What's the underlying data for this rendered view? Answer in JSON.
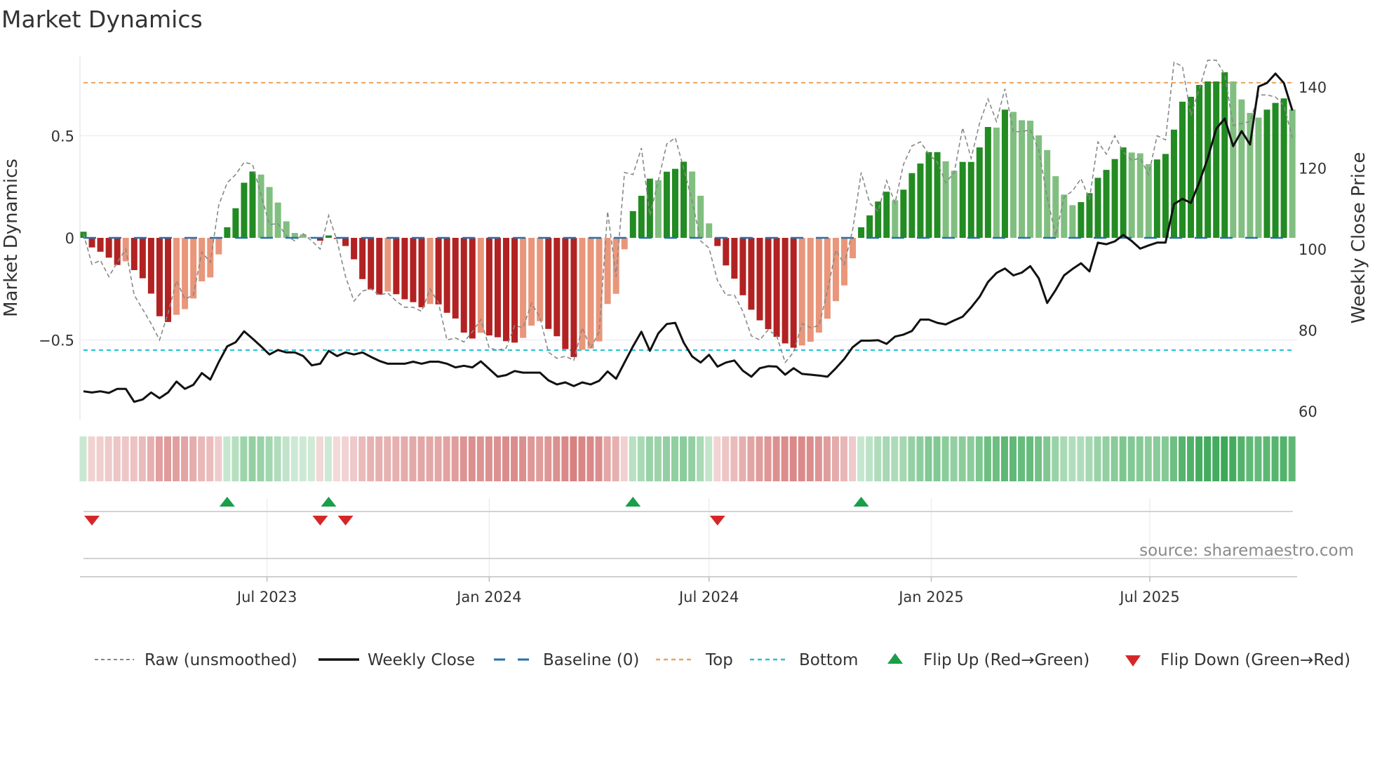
{
  "chart_data": {
    "type": "bar",
    "title": "Market Dynamics",
    "ylabel": "Market Dynamics",
    "ylabel_right": "Weekly Close Price",
    "ylim": [
      -0.75,
      0.95
    ],
    "ylim_right": [
      60,
      148
    ],
    "yticks": [
      {
        "value": 0.5,
        "label": "0.5"
      },
      {
        "value": 0,
        "label": "0"
      },
      {
        "value": -0.5,
        "label": "−0.5"
      }
    ],
    "yticks_right": [
      {
        "value": 140,
        "label": "140"
      },
      {
        "value": 120,
        "label": "120"
      },
      {
        "value": 100,
        "label": "100"
      },
      {
        "value": 80,
        "label": "80"
      },
      {
        "value": 60,
        "label": "60"
      }
    ],
    "xticks": [
      {
        "date": "2023-07-01",
        "label": "Jul 2023"
      },
      {
        "date": "2024-01-01",
        "label": "Jan 2024"
      },
      {
        "date": "2024-07-01",
        "label": "Jul 2024"
      },
      {
        "date": "2025-01-01",
        "label": "Jan 2025"
      },
      {
        "date": "2025-07-01",
        "label": "Jul 2025"
      }
    ],
    "start_week": "2023-01-30",
    "interval_days": 7,
    "top_level": 0.76,
    "bottom_level": -0.55,
    "baseline": 0,
    "grid": "horizontal",
    "legend_placement": "bottom",
    "smoothed": [
      0.03,
      -0.047,
      -0.068,
      -0.097,
      -0.133,
      -0.115,
      -0.158,
      -0.198,
      -0.273,
      -0.384,
      -0.412,
      -0.377,
      -0.349,
      -0.297,
      -0.213,
      -0.194,
      -0.081,
      0.052,
      0.145,
      0.27,
      0.325,
      0.31,
      0.249,
      0.173,
      0.081,
      0.024,
      0.017,
      0.004,
      -0.014,
      0.012,
      -0.005,
      -0.04,
      -0.105,
      -0.202,
      -0.253,
      -0.278,
      -0.263,
      -0.276,
      -0.301,
      -0.315,
      -0.34,
      -0.324,
      -0.326,
      -0.367,
      -0.395,
      -0.464,
      -0.493,
      -0.465,
      -0.478,
      -0.487,
      -0.506,
      -0.513,
      -0.49,
      -0.43,
      -0.408,
      -0.446,
      -0.482,
      -0.545,
      -0.584,
      -0.548,
      -0.542,
      -0.507,
      -0.324,
      -0.274,
      -0.056,
      0.131,
      0.206,
      0.29,
      0.282,
      0.324,
      0.338,
      0.373,
      0.325,
      0.206,
      0.071,
      -0.04,
      -0.135,
      -0.2,
      -0.281,
      -0.352,
      -0.404,
      -0.447,
      -0.485,
      -0.517,
      -0.538,
      -0.527,
      -0.509,
      -0.464,
      -0.396,
      -0.31,
      -0.233,
      -0.1,
      0.052,
      0.11,
      0.178,
      0.226,
      0.184,
      0.236,
      0.317,
      0.364,
      0.42,
      0.42,
      0.375,
      0.329,
      0.372,
      0.372,
      0.443,
      0.543,
      0.54,
      0.628,
      0.617,
      0.576,
      0.574,
      0.502,
      0.43,
      0.302,
      0.212,
      0.16,
      0.175,
      0.219,
      0.294,
      0.333,
      0.386,
      0.443,
      0.418,
      0.414,
      0.361,
      0.384,
      0.411,
      0.53,
      0.667,
      0.691,
      0.749,
      0.766,
      0.766,
      0.811,
      0.766,
      0.678,
      0.612,
      0.589,
      0.628,
      0.661,
      0.683,
      0.629
    ],
    "shade": "DDDDDLDDDDDLLLLLLDDDDLLLLLLLDDDDDDDDLDDDDLDDDDDLDDDDLLLDDDDLLLLLLDDDLDDDLLLDDDDDDDDDDLLLLLLLDDDDLDDDDDLLDDDDLDLLLLLLLLDDDDDDLLLDDDDDDDDDLLLLDDDL",
    "raw": [
      0.02,
      -0.13,
      -0.11,
      -0.19,
      -0.12,
      -0.055,
      -0.28,
      -0.35,
      -0.42,
      -0.5,
      -0.37,
      -0.21,
      -0.3,
      -0.28,
      -0.07,
      -0.12,
      0.16,
      0.27,
      0.31,
      0.37,
      0.36,
      0.21,
      0.065,
      0.07,
      0.01,
      -0.015,
      0.02,
      -0.015,
      -0.055,
      0.11,
      -0.015,
      -0.19,
      -0.31,
      -0.26,
      -0.25,
      -0.28,
      -0.27,
      -0.31,
      -0.34,
      -0.34,
      -0.36,
      -0.25,
      -0.32,
      -0.5,
      -0.49,
      -0.51,
      -0.46,
      -0.4,
      -0.54,
      -0.55,
      -0.54,
      -0.43,
      -0.44,
      -0.32,
      -0.39,
      -0.56,
      -0.59,
      -0.58,
      -0.6,
      -0.44,
      -0.54,
      -0.46,
      0.13,
      -0.19,
      0.32,
      0.31,
      0.44,
      0.11,
      0.28,
      0.46,
      0.49,
      0.34,
      0.18,
      -0.015,
      -0.05,
      -0.21,
      -0.28,
      -0.28,
      -0.36,
      -0.48,
      -0.5,
      -0.45,
      -0.48,
      -0.61,
      -0.56,
      -0.42,
      -0.44,
      -0.43,
      -0.26,
      -0.06,
      -0.13,
      0.04,
      0.32,
      0.17,
      0.13,
      0.28,
      0.17,
      0.36,
      0.45,
      0.47,
      0.41,
      0.37,
      0.27,
      0.32,
      0.54,
      0.39,
      0.56,
      0.68,
      0.57,
      0.73,
      0.52,
      0.52,
      0.53,
      0.43,
      0.2,
      0.01,
      0.2,
      0.23,
      0.29,
      0.19,
      0.47,
      0.41,
      0.5,
      0.42,
      0.38,
      0.39,
      0.31,
      0.5,
      0.48,
      0.86,
      0.84,
      0.6,
      0.73,
      0.87,
      0.87,
      0.8,
      0.55,
      0.56,
      0.57,
      0.7,
      0.7,
      0.69,
      0.65,
      0.49
    ],
    "close": [
      64.9,
      64.6,
      64.9,
      64.5,
      65.5,
      65.5,
      62.3,
      62.9,
      64.6,
      63.2,
      64.6,
      67.3,
      65.5,
      66.5,
      69.4,
      67.8,
      72.1,
      76,
      77,
      79.7,
      77.9,
      76,
      74,
      75.1,
      74.5,
      74.5,
      73.6,
      71.3,
      71.7,
      74.9,
      73.6,
      74.5,
      74,
      74.5,
      73.4,
      72.4,
      71.7,
      71.7,
      71.7,
      72.2,
      71.7,
      72.2,
      72.2,
      71.7,
      70.8,
      71.2,
      70.8,
      72.3,
      70.4,
      68.5,
      68.9,
      69.9,
      69.5,
      69.5,
      69.5,
      67.6,
      66.6,
      67.1,
      66.2,
      67.1,
      66.6,
      67.5,
      69.8,
      68,
      72,
      76,
      79.6,
      74.9,
      79.2,
      81.5,
      81.8,
      76.9,
      73.5,
      72,
      73.9,
      71,
      72,
      72.5,
      70,
      68.5,
      70.6,
      71.1,
      71,
      69,
      70.6,
      69.2,
      69,
      68.8,
      68.5,
      70.6,
      72.9,
      75.8,
      77.4,
      77.4,
      77.5,
      76.6,
      78.4,
      78.9,
      79.8,
      82.6,
      82.6,
      81.8,
      81.4,
      82.4,
      83.3,
      85.6,
      88.2,
      91.9,
      94.1,
      95.2,
      93.5,
      94.2,
      95.8,
      92.8,
      86.7,
      89.9,
      93.5,
      95.1,
      96.5,
      94.5,
      101.6,
      101.2,
      101.9,
      103.5,
      102,
      100.1,
      100.9,
      101.6,
      101.6,
      111.1,
      112.4,
      111.4,
      116.5,
      122.5,
      129.7,
      132.2,
      125.4,
      129.1,
      125.8,
      140.1,
      141,
      143.3,
      141,
      134.2
    ],
    "flip_up": [
      "2023-05-29",
      "2023-08-21",
      "2024-04-29",
      "2024-11-04"
    ],
    "flip_down": [
      "2023-02-06",
      "2023-08-14",
      "2023-09-04",
      "2024-07-08"
    ],
    "colors": {
      "dark_green": "#228b22",
      "light_green": "#80bf80",
      "dark_red": "#b22222",
      "light_red": "#e9967a",
      "raw": "#888888",
      "close": "#111111",
      "baseline": "#2a6fa8",
      "top": "#eaa35f",
      "bottom": "#22c3d6",
      "flip_up": "#1a9e4a",
      "flip_down": "#d62728"
    },
    "legend": [
      {
        "key": "raw",
        "label": "Raw (unsmoothed)"
      },
      {
        "key": "close",
        "label": "Weekly Close"
      },
      {
        "key": "baseline",
        "label": "Baseline (0)"
      },
      {
        "key": "top",
        "label": "Top"
      },
      {
        "key": "bottom",
        "label": "Bottom"
      },
      {
        "key": "flip_up",
        "label": "Flip Up (Red→Green)"
      },
      {
        "key": "flip_down",
        "label": "Flip Down (Green→Red)"
      }
    ],
    "source": "source: sharemaestro.com"
  }
}
